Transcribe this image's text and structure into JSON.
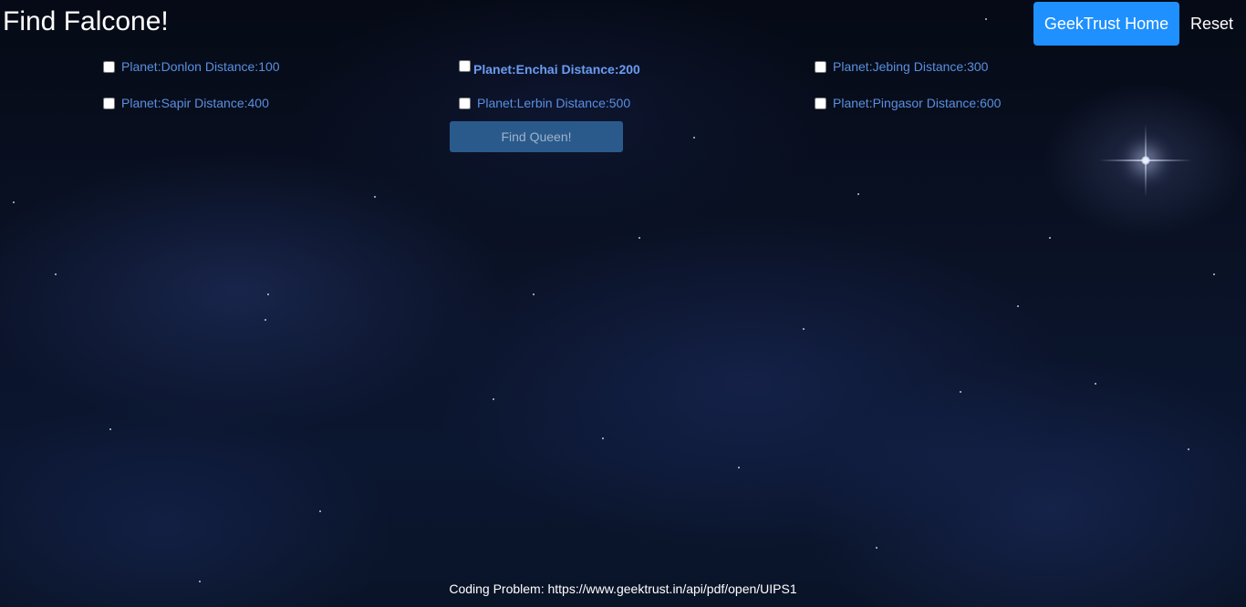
{
  "header": {
    "title": "Find Falcone!",
    "home_label": "GeekTrust Home",
    "reset_label": "Reset"
  },
  "planets": [
    {
      "label": "Planet:Donlon Distance:100",
      "checked": false,
      "selected": false
    },
    {
      "label": "Planet:Enchai Distance:200",
      "checked": false,
      "selected": true
    },
    {
      "label": "Planet:Jebing Distance:300",
      "checked": false,
      "selected": false
    },
    {
      "label": "Planet:Sapir Distance:400",
      "checked": false,
      "selected": false
    },
    {
      "label": "Planet:Lerbin Distance:500",
      "checked": false,
      "selected": false
    },
    {
      "label": "Planet:Pingasor Distance:600",
      "checked": false,
      "selected": false
    }
  ],
  "actions": {
    "find_label": "Find Queen!"
  },
  "footer": {
    "text": "Coding Problem: https://www.geektrust.in/api/pdf/open/UIPS1"
  },
  "colors": {
    "home_button": "#1e90ff",
    "find_button": "#2a5a8c",
    "planet_label": "#5a8fe0"
  }
}
